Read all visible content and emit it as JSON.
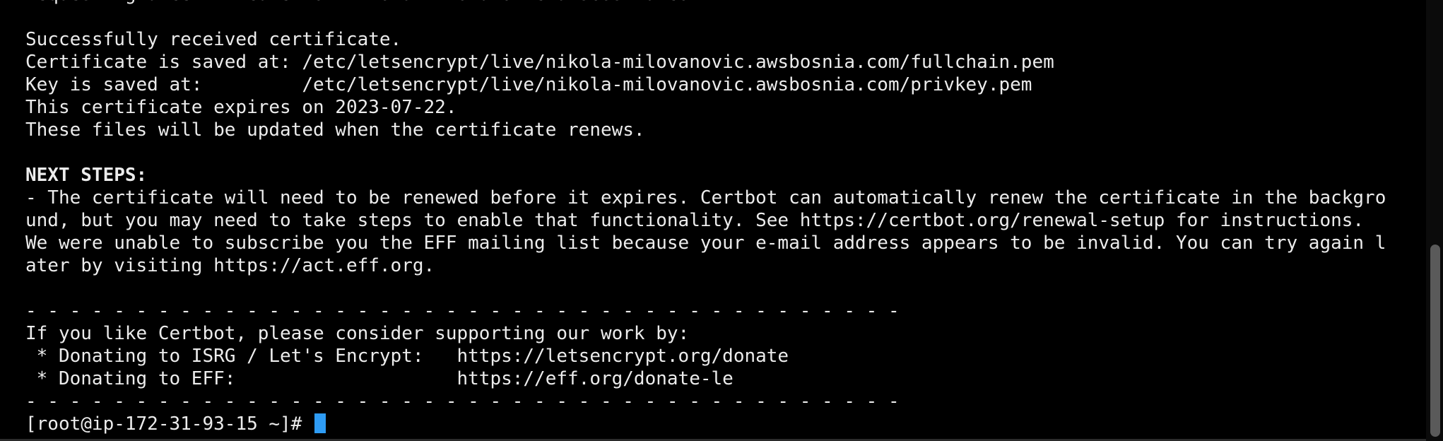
{
  "terminal": {
    "lines": {
      "l00": "Requesting a certificate for nikola-milovanovic.awsbosnia.com",
      "l02": "Successfully received certificate.",
      "l03": "Certificate is saved at: /etc/letsencrypt/live/nikola-milovanovic.awsbosnia.com/fullchain.pem",
      "l04": "Key is saved at:         /etc/letsencrypt/live/nikola-milovanovic.awsbosnia.com/privkey.pem",
      "l05": "This certificate expires on 2023-07-22.",
      "l06": "These files will be updated when the certificate renews.",
      "l08": "NEXT STEPS:",
      "l09": "- The certificate will need to be renewed before it expires. Certbot can automatically renew the certificate in the backgro",
      "l10": "und, but you may need to take steps to enable that functionality. See https://certbot.org/renewal-setup for instructions.",
      "l11": "We were unable to subscribe you the EFF mailing list because your e-mail address appears to be invalid. You can try again l",
      "l12": "ater by visiting https://act.eff.org.",
      "l14": "- - - - - - - - - - - - - - - - - - - - - - - - - - - - - - - - - - - - - - - -",
      "l15": "If you like Certbot, please consider supporting our work by:",
      "l16": " * Donating to ISRG / Let's Encrypt:   https://letsencrypt.org/donate",
      "l17": " * Donating to EFF:                    https://eff.org/donate-le",
      "l18": "- - - - - - - - - - - - - - - - - - - - - - - - - - - - - - - - - - - - - - - -"
    },
    "prompt": "[root@ip-172-31-93-15 ~]# "
  },
  "colors": {
    "background": "#000000",
    "text": "#ececec",
    "cursor": "#2e9cf5",
    "scrollbar_thumb": "#5a5a5a"
  }
}
